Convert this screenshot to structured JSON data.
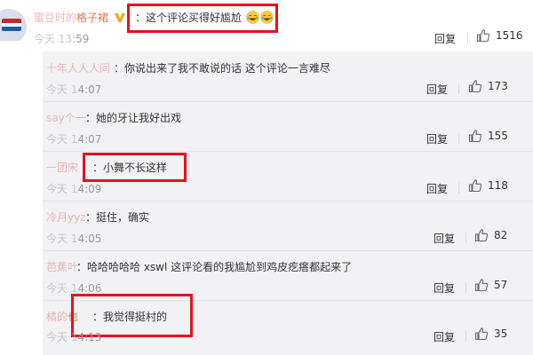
{
  "main_comment": {
    "author_faded": "蜜豆时的",
    "author_visible": "格子裙",
    "separator": "：",
    "text": "这个评论买得好尴尬",
    "emojis": [
      "laugh-cry-emoji",
      "laugh-cry-emoji"
    ],
    "time_faded": "今天 13",
    "time_visible": ":59",
    "reply_label": "回复",
    "likes": "1516"
  },
  "replies": [
    {
      "author_faded": "十年人人人间",
      "separator": "：",
      "text": "你说出来了我不敢说的话 这个评论一言难尽",
      "time_faded": "今天 1",
      "time_visible": "4:07",
      "reply_label": "回复",
      "likes": "173"
    },
    {
      "author_faded": "say个一",
      "separator": "：",
      "text": "她的牙让我好出戏",
      "time_faded": "今天 1",
      "time_visible": "4:07",
      "reply_label": "回复",
      "likes": "155"
    },
    {
      "author_faded": "一团宋",
      "separator": "：",
      "text": "小舞不长这样",
      "time_faded": "今天 1",
      "time_visible": "4:09",
      "reply_label": "回复",
      "likes": "118"
    },
    {
      "author_faded": "冷月yyz",
      "separator": "：",
      "text": "挺住，确实",
      "time_faded": "今天 1",
      "time_visible": "4:05",
      "reply_label": "回复",
      "likes": "82"
    },
    {
      "author_faded": "芭蕉叶",
      "separator": "：",
      "text": "哈哈哈哈哈 xswl 这评论看的我尴尬到鸡皮疙瘩都起来了",
      "time_faded": "今天 1",
      "time_visible": "4:06",
      "reply_label": "回复",
      "likes": "57"
    },
    {
      "author_faded": "橘的",
      "author_visible": "也",
      "separator": "：",
      "text": "我觉得挺村的",
      "time_faded": "今天 1",
      "time_visible": "4:13",
      "reply_label": "回复",
      "likes": "35"
    }
  ],
  "colors": {
    "username": "#eb7350",
    "highlight_box": "#e8101f",
    "nested_background": "#f2f2f5"
  },
  "icons": {
    "like": "thumbs-up-icon",
    "verified": "vip-badge-icon"
  }
}
